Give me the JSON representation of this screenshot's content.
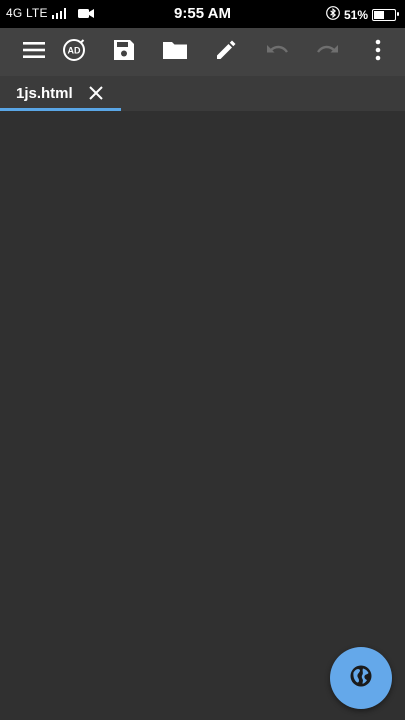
{
  "status_bar": {
    "network": "4G LTE",
    "time": "9:55 AM",
    "battery_percent": "51%",
    "battery_level": 0.51,
    "icons": [
      "signal-icon",
      "video-camera-icon",
      "bluetooth-icon",
      "battery-icon"
    ]
  },
  "toolbar": {
    "buttons": [
      {
        "icon": "menu-icon"
      },
      {
        "icon": "ad-icon",
        "label": "AD"
      },
      {
        "icon": "save-icon"
      },
      {
        "icon": "folder-icon"
      },
      {
        "icon": "pencil-icon"
      },
      {
        "icon": "undo-icon",
        "enabled": false
      },
      {
        "icon": "redo-icon",
        "enabled": false
      },
      {
        "icon": "more-vert-icon"
      }
    ]
  },
  "tabs": [
    {
      "label": "1js.html",
      "active": true
    }
  ],
  "fab": {
    "icon": "globe-icon"
  },
  "colors": {
    "status_bar": "#000000",
    "toolbar": "#424242",
    "tab_bar": "#3b3b3b",
    "editor_background": "#303030",
    "accent": "#5aa6e6",
    "fab": "#64a8ea",
    "disabled_icon": "#6f6f6f"
  }
}
